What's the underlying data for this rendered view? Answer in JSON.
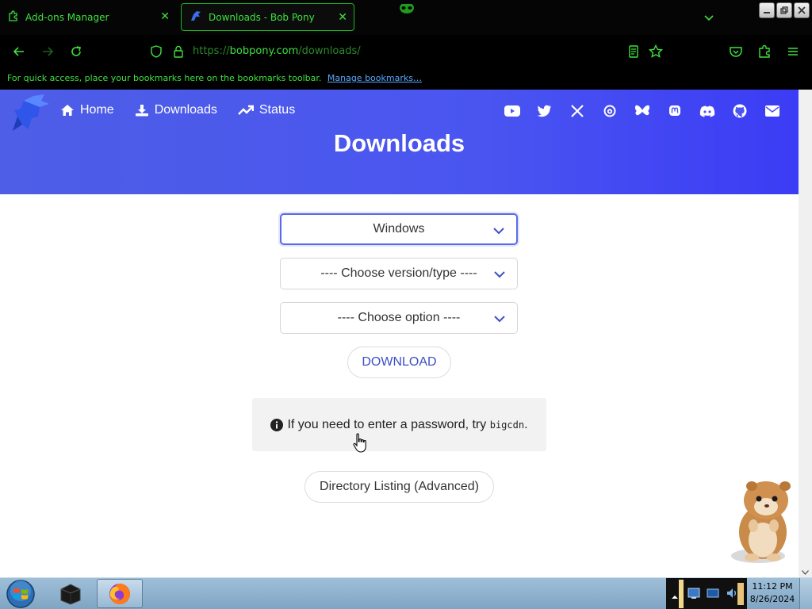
{
  "browser": {
    "tabs": [
      {
        "title": "Add-ons Manager",
        "icon": "puzzle-icon",
        "active": false
      },
      {
        "title": "Downloads - Bob Pony",
        "icon": "bobpony-icon",
        "active": true
      }
    ],
    "url": {
      "scheme": "https://",
      "host": "bobpony.com",
      "path": "/downloads/"
    },
    "bookmarks_bar": {
      "message": "For quick access, place your bookmarks here on the bookmarks toolbar.",
      "link": "Manage bookmarks…"
    },
    "accent_color": "#3de23d"
  },
  "site": {
    "nav": [
      {
        "label": "Home",
        "icon": "home-icon"
      },
      {
        "label": "Downloads",
        "icon": "download-icon"
      },
      {
        "label": "Status",
        "icon": "trend-icon"
      }
    ],
    "social": [
      "youtube-icon",
      "twitter-icon",
      "x-icon",
      "threads-icon",
      "bluesky-icon",
      "mastodon-icon",
      "discord-icon",
      "github-icon",
      "mail-icon"
    ],
    "hero_title": "Downloads",
    "hero_color": "#4a55f0"
  },
  "form": {
    "os_select": "Windows",
    "version_select": "---- Choose version/type ----",
    "option_select": "---- Choose option ----",
    "download_label": "DOWNLOAD"
  },
  "notice": {
    "text_before": "If you need to enter a password, try",
    "password": "bigcdn",
    "text_after": "."
  },
  "directory_button": "Directory Listing (Advanced)",
  "taskbar": {
    "time": "11:12 PM",
    "date": "8/26/2024"
  }
}
